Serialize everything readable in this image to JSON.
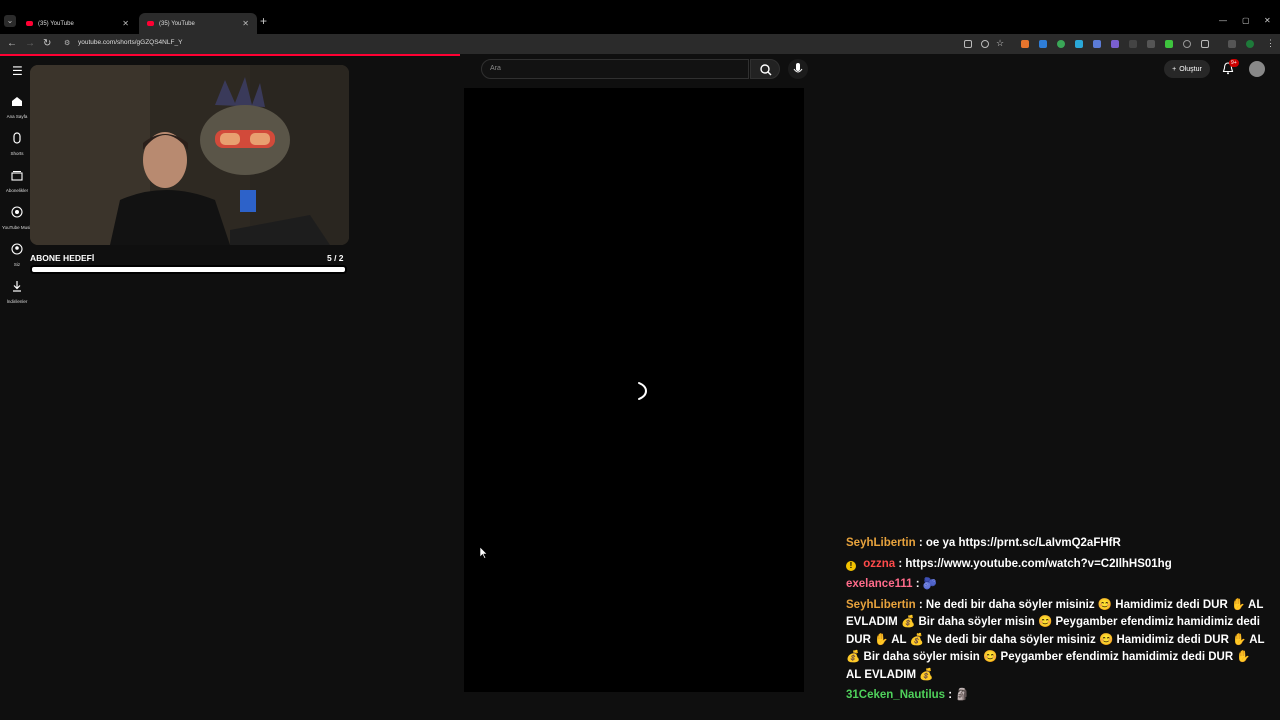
{
  "browser": {
    "tabs": [
      {
        "title": "(35) YouTube",
        "active": false
      },
      {
        "title": "(35) YouTube",
        "active": true
      }
    ],
    "url": "youtube.com/shorts/gGZQS4NLF_Y"
  },
  "masthead": {
    "search_placeholder": "Ara",
    "create_label": "Oluştur",
    "notification_badge": "9+"
  },
  "guide": {
    "items": [
      {
        "label": "Ana Sayfa",
        "icon": "home-icon"
      },
      {
        "label": "Shorts",
        "icon": "shorts-icon"
      },
      {
        "label": "Abonelikler",
        "icon": "subscriptions-icon"
      },
      {
        "label": "YouTube Music",
        "icon": "music-icon"
      },
      {
        "label": "Siz",
        "icon": "you-icon"
      },
      {
        "label": "İndirilenler",
        "icon": "download-icon"
      }
    ]
  },
  "overlay": {
    "goal_title": "ABONE HEDEFİ",
    "goal_count": "5  / 2",
    "goal_progress": 1.0
  },
  "chat": {
    "messages": [
      {
        "user": "SeyhLibertin",
        "text": ": oe ya https://prnt.sc/LaIvmQ2aFHfR",
        "color": "#e8a33d"
      },
      {
        "user": "ozzna",
        "text": ": https://www.youtube.com/watch?v=C2IlhHS01hg",
        "color": "#ff4b4b",
        "badge": "!"
      },
      {
        "user": "exelance111",
        "text": ": 🫐",
        "color": "#ff6b8a"
      },
      {
        "user": "SeyhLibertin",
        "text": ": Ne dedi bir daha söyler misiniz 😊 Hamidimiz dedi DUR ✋ AL EVLADIM 💰 Bir daha söyler misin 😊 Peygamber efendimiz hamidimiz dedi DUR ✋ AL 💰 Ne dedi bir daha söyler misiniz 😊 Hamidimiz dedi DUR ✋ AL 💰 Bir daha söyler misin 😊 Peygamber efendimiz hamidimiz dedi DUR ✋ AL EVLADIM 💰",
        "color": "#e8a33d"
      },
      {
        "user": "31Ceken_Nautilus",
        "text": ": 🗿",
        "color": "#4fd15b"
      }
    ]
  }
}
